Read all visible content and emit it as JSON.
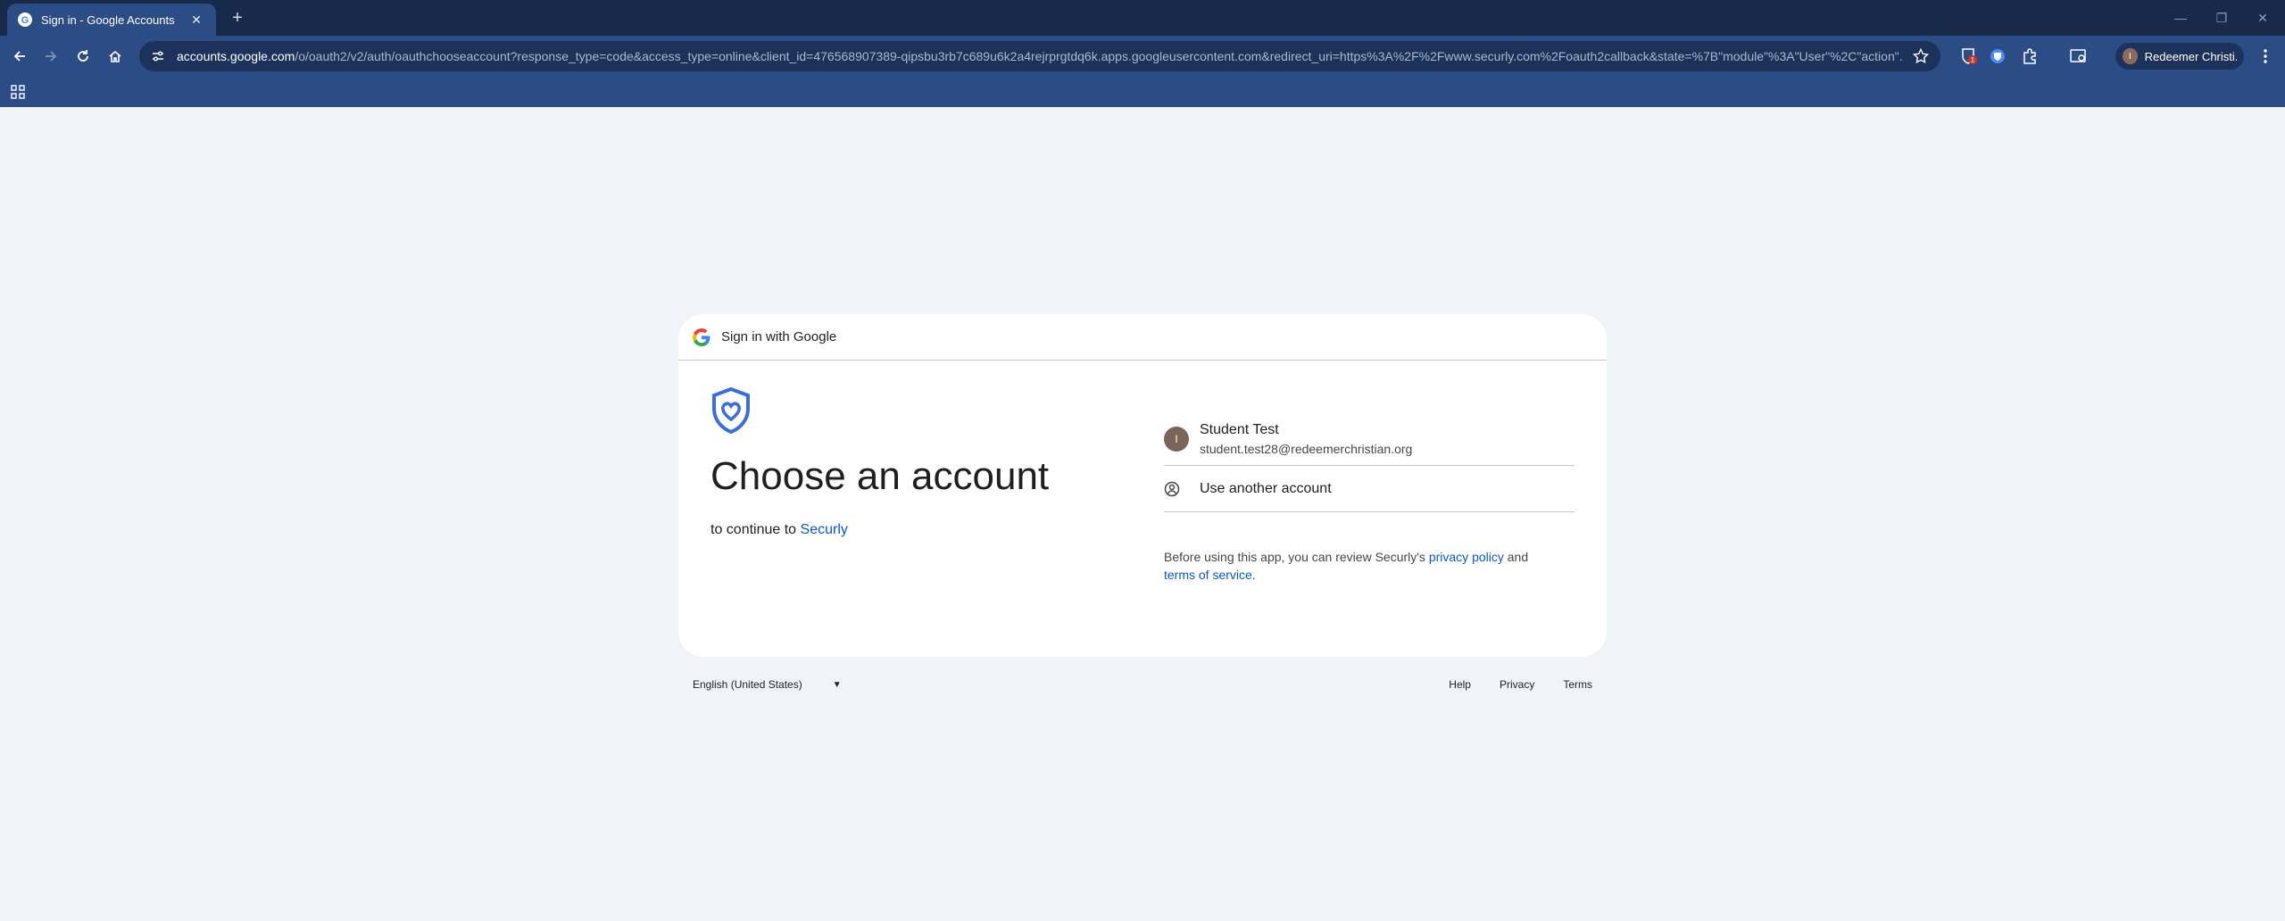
{
  "browser": {
    "tab_title": "Sign in - Google Accounts",
    "url_host": "accounts.google.com",
    "url_path": "/o/oauth2/v2/auth/oauthchooseaccount?response_type=code&access_type=online&client_id=476568907389-qipsbu3rb7c689u6k2a4rejrprgtdq6k.apps.googleusercontent.com&redirect_uri=https%3A%2F%2Fwww.securly.com%2Foauth2callback&state=%7B\"module\"%3A\"User\"%2C\"action\"...",
    "profile_initial": "I",
    "profile_name": "Redeemer Christi...",
    "extension_badge": "1",
    "colors": {
      "tabstrip": "#182a4a",
      "toolbar": "#2b4c85",
      "omnibox": "#1c325a"
    }
  },
  "card": {
    "header_text": "Sign in with Google",
    "heading": "Choose an account",
    "subtitle_prefix": "to continue to",
    "app_name": "Securly",
    "account": {
      "initial": "I",
      "name": "Student Test",
      "email": "student.test28@redeemerchristian.org"
    },
    "use_another": "Use another account",
    "disclaimer": {
      "prefix": "Before using this app, you can review Securly's",
      "privacy_link": "privacy policy",
      "and": "and",
      "terms_link": "terms of service."
    },
    "colors": {
      "link": "#0b57d0",
      "background": "#f0f4f9"
    }
  },
  "footer": {
    "language": "English (United States)",
    "links": [
      "Help",
      "Privacy",
      "Terms"
    ]
  }
}
